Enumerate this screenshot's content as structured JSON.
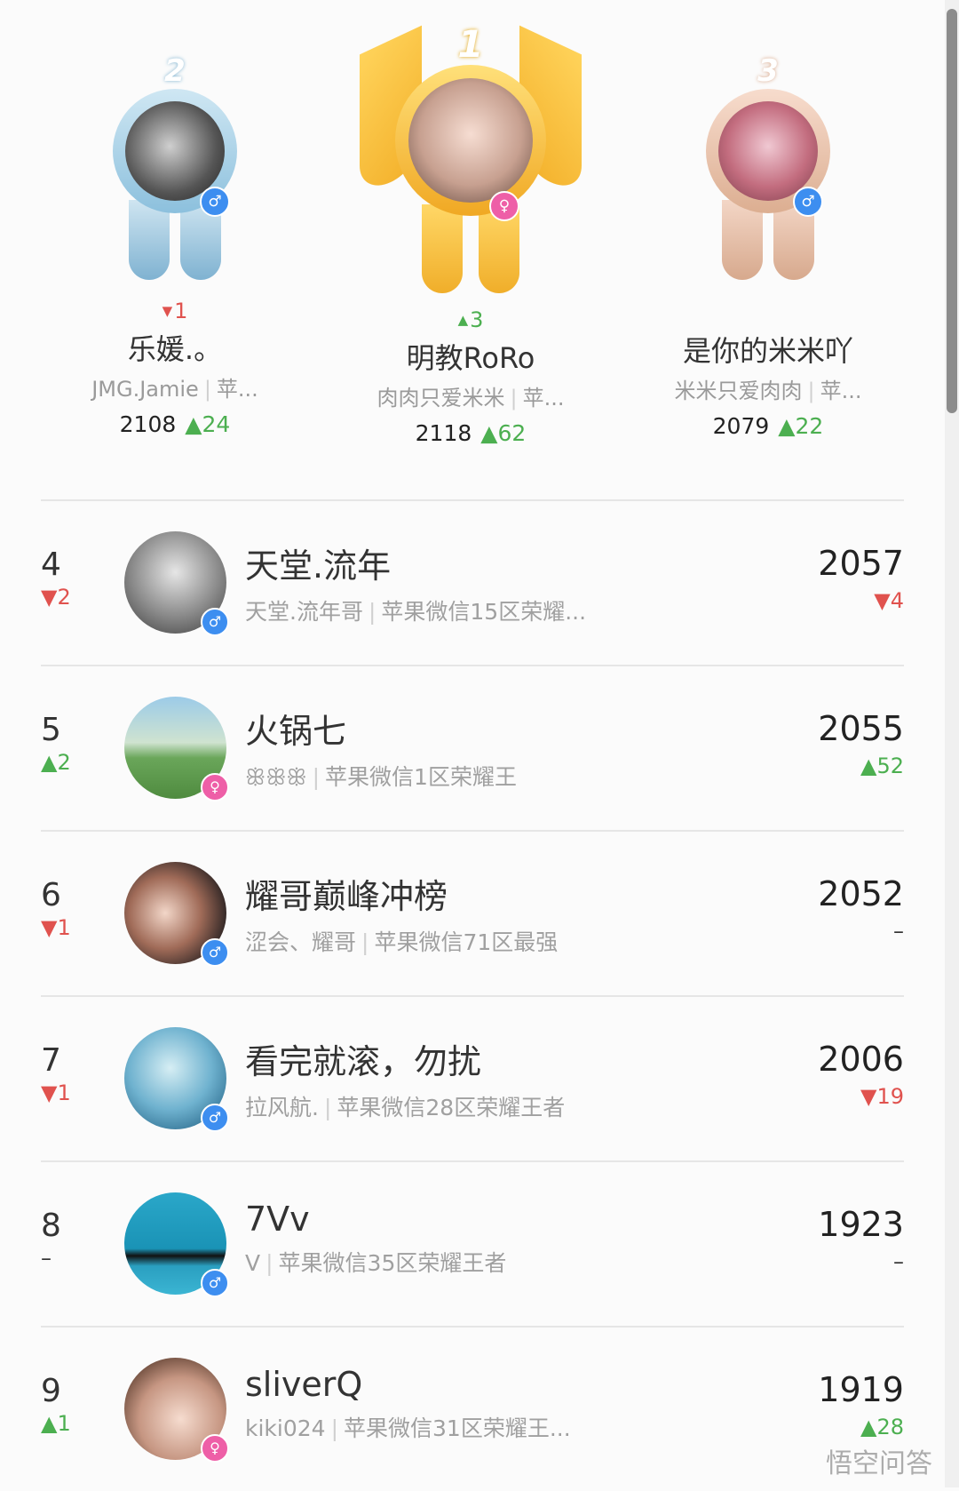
{
  "podium": {
    "second": {
      "crown_label": "2",
      "change_dir": "▼",
      "change_value": "1",
      "name": "乐媛.。",
      "sub_a": "JMG.Jamie",
      "sub_b": "苹...",
      "score": "2108",
      "delta": "▲24",
      "gender": "♂"
    },
    "first": {
      "crown_label": "1",
      "change_dir": "▲",
      "change_value": "3",
      "name": "明教RoRo",
      "sub_a": "肉肉只爱米米",
      "sub_b": "苹...",
      "score": "2118",
      "delta": "▲62",
      "gender": "♀"
    },
    "third": {
      "crown_label": "3",
      "change_dir": "",
      "change_value": "",
      "name": "是你的米米吖",
      "sub_a": "米米只爱肉肉",
      "sub_b": "苹...",
      "score": "2079",
      "delta": "▲22",
      "gender": "♂"
    }
  },
  "rows": [
    {
      "rank": "4",
      "rank_change": "▼2",
      "name": "天堂.流年",
      "sub_a": "天堂.流年哥",
      "sub_b": "苹果微信15区荣耀...",
      "score": "2057",
      "delta": "▼4",
      "gender": "♂"
    },
    {
      "rank": "5",
      "rank_change": "▲2",
      "name": "火锅七",
      "sub_a": "ꕥꕥꕥ",
      "sub_b": "苹果微信1区荣耀王",
      "score": "2055",
      "delta": "▲52",
      "gender": "♀"
    },
    {
      "rank": "6",
      "rank_change": "▼1",
      "name": "耀哥巅峰冲榜",
      "sub_a": "涩会、耀哥",
      "sub_b": "苹果微信71区最强",
      "score": "2052",
      "delta": "–",
      "gender": "♂"
    },
    {
      "rank": "7",
      "rank_change": "▼1",
      "name": "看完就滚，勿扰",
      "sub_a": "拉风航.",
      "sub_b": "苹果微信28区荣耀王者",
      "score": "2006",
      "delta": "▼19",
      "gender": "♂"
    },
    {
      "rank": "8",
      "rank_change": "–",
      "name": "7Vv",
      "sub_a": "V",
      "sub_b": "苹果微信35区荣耀王者",
      "score": "1923",
      "delta": "–",
      "gender": "♂"
    },
    {
      "rank": "9",
      "rank_change": "▲1",
      "name": "sliverQ",
      "sub_a": "kiki024",
      "sub_b": "苹果微信31区荣耀王...",
      "score": "1919",
      "delta": "▲28",
      "gender": "♀"
    }
  ],
  "watermark": "悟空问答",
  "colors": {
    "up": "#4caf50",
    "down": "#e0524e",
    "male": "#3d8ef0",
    "female": "#ee5fa7"
  }
}
